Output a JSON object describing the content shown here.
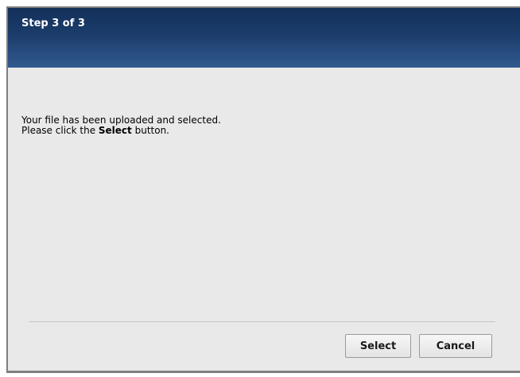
{
  "dialog": {
    "title": "Step 3 of 3",
    "message_line1": "Your file has been uploaded and selected.",
    "message_line2_prefix": "Please click the ",
    "message_line2_bold": "Select",
    "message_line2_suffix": " button."
  },
  "buttons": {
    "select_label": "Select",
    "cancel_label": "Cancel"
  },
  "colors": {
    "header_dark": "#13305a",
    "header_light": "#325a8e",
    "body_background": "#e9e9e9"
  }
}
